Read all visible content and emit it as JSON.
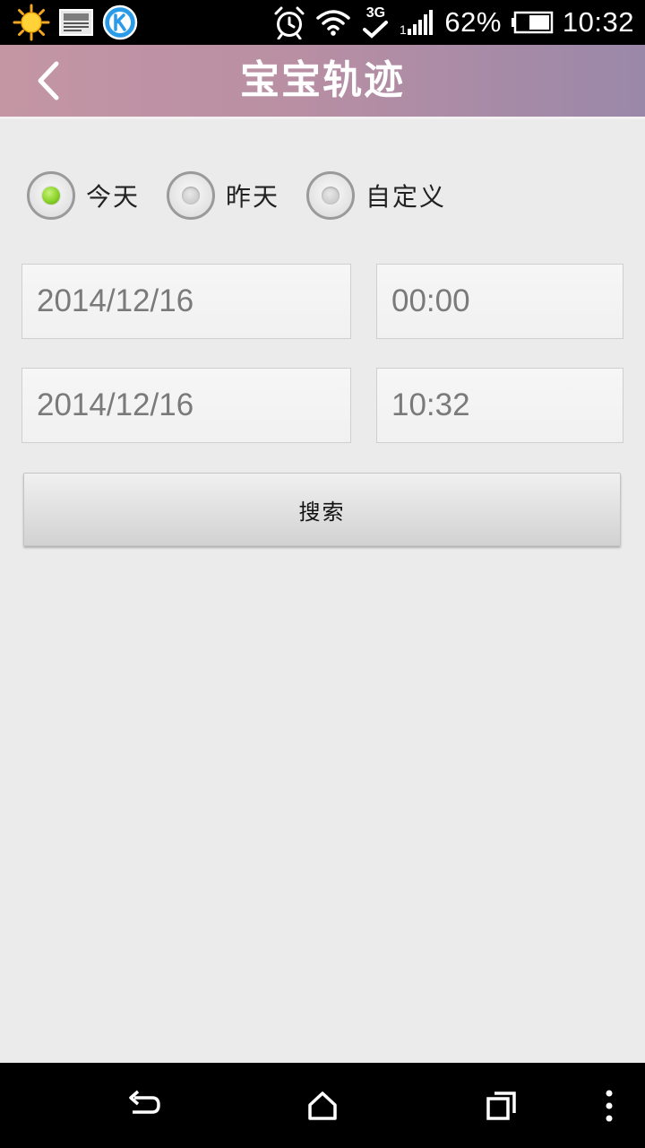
{
  "status_bar": {
    "left_icons": [
      "sun-weather-icon",
      "image-notification-icon",
      "k-app-icon"
    ],
    "right_icons": [
      "alarm-clock-icon",
      "wifi-icon",
      "3g-data-icon",
      "signal-strength-icon",
      "battery-icon"
    ],
    "network_label": "3G",
    "battery_percent": "62%",
    "time": "10:32"
  },
  "header": {
    "title": "宝宝轨迹",
    "back_icon": "chevron-left-icon",
    "colors": {
      "gradient_start": "#c496a4",
      "gradient_end": "#9a88a9"
    }
  },
  "date_range_options": [
    {
      "label": "今天",
      "selected": true
    },
    {
      "label": "昨天",
      "selected": false
    },
    {
      "label": "自定义",
      "selected": false
    }
  ],
  "start": {
    "date": "2014/12/16",
    "time": "00:00"
  },
  "end": {
    "date": "2014/12/16",
    "time": "10:32"
  },
  "search_button": {
    "label": "搜索"
  },
  "nav_bar": {
    "icons": [
      "back-icon",
      "home-icon",
      "recent-apps-icon",
      "overflow-menu-icon"
    ]
  },
  "colors": {
    "accent_selected": "#8ad22a",
    "background": "#ebebeb"
  }
}
